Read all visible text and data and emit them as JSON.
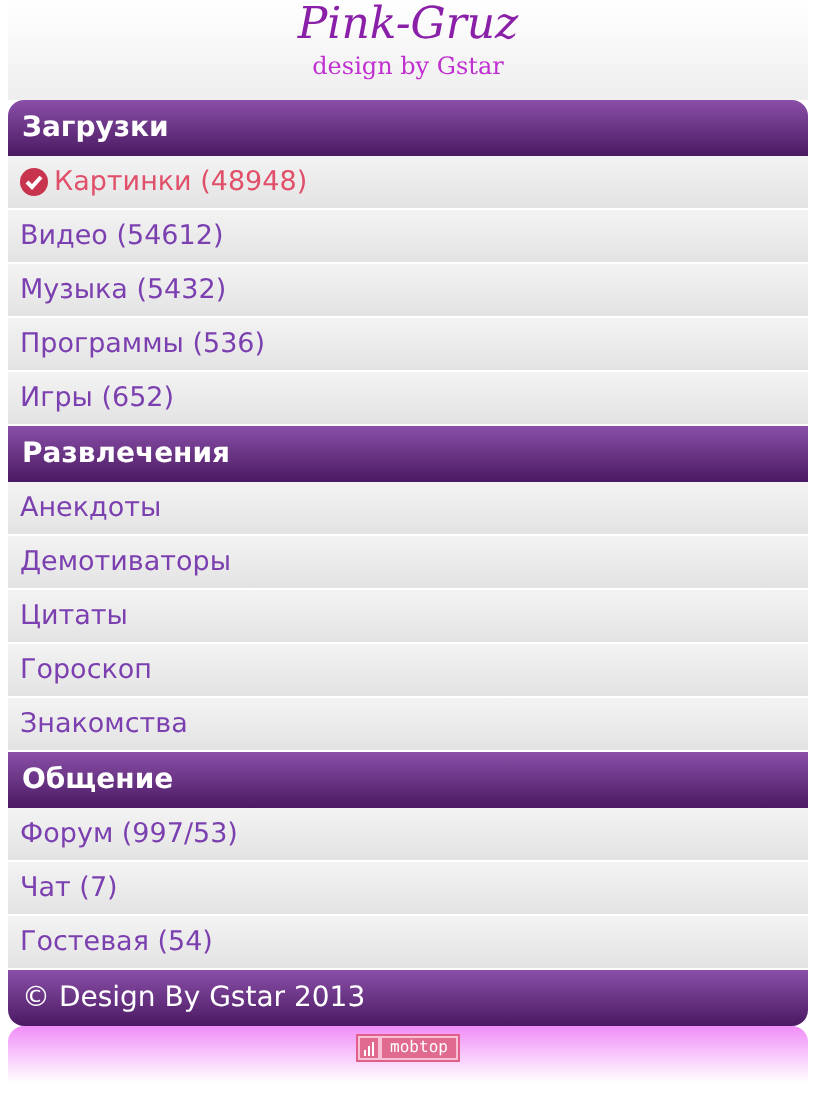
{
  "header": {
    "title": "Pink-Gruz",
    "subtitle": "design by Gstar"
  },
  "sections": [
    {
      "title": "Загрузки",
      "items": [
        {
          "label": "Картинки (48948)",
          "selected": true
        },
        {
          "label": "Видео (54612)",
          "selected": false
        },
        {
          "label": "Музыка (5432)",
          "selected": false
        },
        {
          "label": "Программы (536)",
          "selected": false
        },
        {
          "label": "Игры (652)",
          "selected": false
        }
      ]
    },
    {
      "title": "Развлечения",
      "items": [
        {
          "label": "Анекдоты",
          "selected": false
        },
        {
          "label": "Демотиваторы",
          "selected": false
        },
        {
          "label": "Цитаты",
          "selected": false
        },
        {
          "label": "Гороскоп",
          "selected": false
        },
        {
          "label": "Знакомства",
          "selected": false
        }
      ]
    },
    {
      "title": "Общение",
      "items": [
        {
          "label": "Форум (997/53)",
          "selected": false
        },
        {
          "label": "Чат (7)",
          "selected": false
        },
        {
          "label": "Гостевая (54)",
          "selected": false
        }
      ]
    }
  ],
  "footer": "© Design By Gstar 2013",
  "counter": {
    "label": "mobtop"
  }
}
